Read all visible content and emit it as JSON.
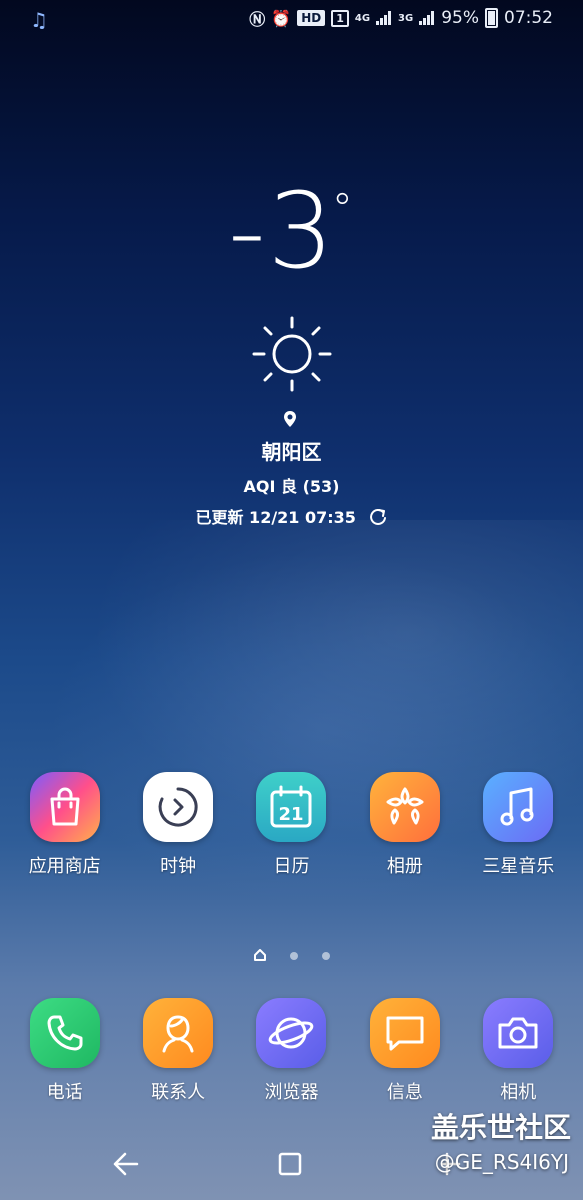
{
  "status_bar": {
    "left_icon": "music-note-icon",
    "hd_badge": "HD",
    "sim_badge": "1",
    "net1": "4G",
    "net2": "3G",
    "battery": "95%",
    "time": "07:52"
  },
  "weather": {
    "temperature": "-3",
    "degree_symbol": "°",
    "condition_icon": "sun-icon",
    "location": "朝阳区",
    "aqi": "AQI 良 (53)",
    "updated": "已更新 12/21 07:35"
  },
  "apps_row": [
    {
      "label": "应用商店",
      "icon": "shopping-bag-icon"
    },
    {
      "label": "时钟",
      "icon": "clock-icon"
    },
    {
      "label": "日历",
      "icon": "calendar-icon",
      "day": "21"
    },
    {
      "label": "相册",
      "icon": "flower-icon"
    },
    {
      "label": "三星音乐",
      "icon": "music-icon"
    }
  ],
  "dock": [
    {
      "label": "电话",
      "icon": "phone-icon"
    },
    {
      "label": "联系人",
      "icon": "contact-icon"
    },
    {
      "label": "浏览器",
      "icon": "planet-icon"
    },
    {
      "label": "信息",
      "icon": "message-icon"
    },
    {
      "label": "相机",
      "icon": "camera-icon"
    }
  ],
  "pager": {
    "pages": 3,
    "current": "home"
  },
  "watermark": {
    "line1": "盖乐世社区",
    "line2": "@GE_RS4I6YJ"
  },
  "colors": {
    "store": "#f0457a",
    "clock": "#ffffff",
    "calendar": "#32c0c8",
    "gallery": "#ff9a2f",
    "music": "#6b86f5",
    "phone": "#26c96b",
    "contacts": "#ff9a24",
    "browser": "#7b6cf0",
    "messages": "#ff9a24",
    "camera": "#7d6ff2"
  }
}
